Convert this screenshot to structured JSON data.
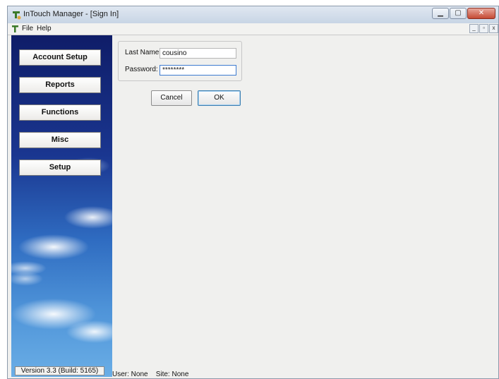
{
  "window": {
    "title": "InTouch Manager - [Sign In]"
  },
  "menu": {
    "items": [
      "File",
      "Help"
    ]
  },
  "sidebar": {
    "buttons": [
      "Account Setup",
      "Reports",
      "Functions",
      "Misc",
      "Setup"
    ],
    "version": "Version 3.3 (Build: 5165)"
  },
  "signin": {
    "last_name_label": "Last Name:",
    "last_name_value": "cousino",
    "password_label": "Password:",
    "password_value": "********",
    "cancel_label": "Cancel",
    "ok_label": "OK"
  },
  "status": {
    "text": "User: None    Site: None"
  },
  "colors": {
    "accent": "#3d7bd0",
    "sidebar_top": "#0f1d68",
    "sidebar_bottom": "#6aaee6"
  },
  "icons": [
    "app-icon",
    "minimize-icon",
    "maximize-icon",
    "close-icon"
  ]
}
